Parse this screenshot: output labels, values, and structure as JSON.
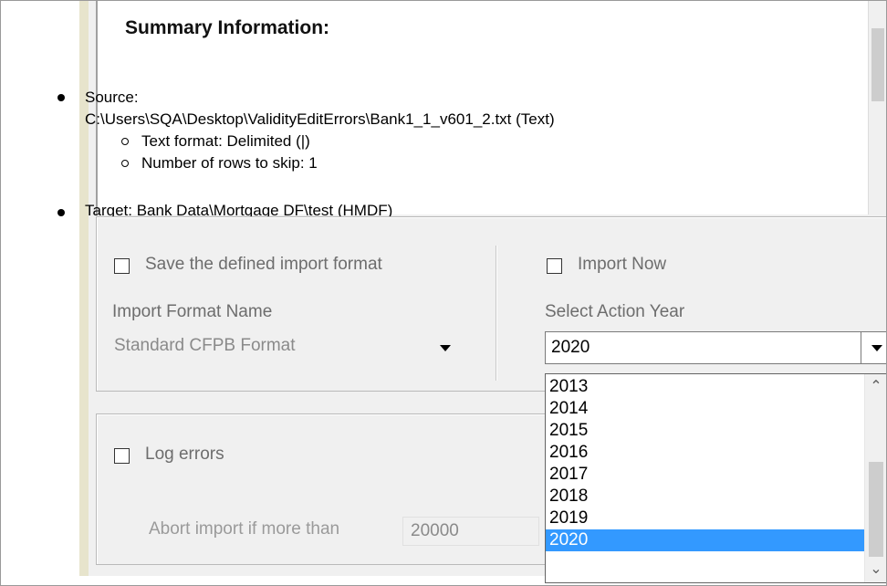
{
  "summary": {
    "title": "Summary Information:",
    "source_label": "Source:",
    "source_path": "C:\\Users\\SQA\\Desktop\\ValidityEditErrors\\Bank1_1_v601_2.txt (Text)",
    "text_format": "Text format: Delimited (|)",
    "rows_to_skip": "Number of rows to skip: 1",
    "target_partial": "Target: Bank Data\\Mortgage DF\\test (HMDF)"
  },
  "import_format": {
    "save_checkbox_label": "Save the defined import format",
    "save_checked": false,
    "name_label": "Import Format Name",
    "name_value": "Standard CFPB Format"
  },
  "import_now": {
    "checkbox_label": "Import Now",
    "checked": false,
    "year_label": "Select Action Year",
    "selected_year": "2020",
    "options": [
      "2013",
      "2014",
      "2015",
      "2016",
      "2017",
      "2018",
      "2019",
      "2020"
    ],
    "selected_index": 7
  },
  "errors": {
    "log_checkbox_label": "Log errors",
    "log_checked": false,
    "abort_label": "Abort import if more than",
    "abort_value": "20000"
  },
  "colors": {
    "frame_olive": "#e7e4cc",
    "dialog_bg": "#f0f0f0",
    "selection": "#3399ff"
  },
  "icons": {
    "dropdown_arrow": "chevron-down-icon",
    "scroll_up": "chevron-up-icon",
    "scroll_down": "chevron-down-icon"
  }
}
